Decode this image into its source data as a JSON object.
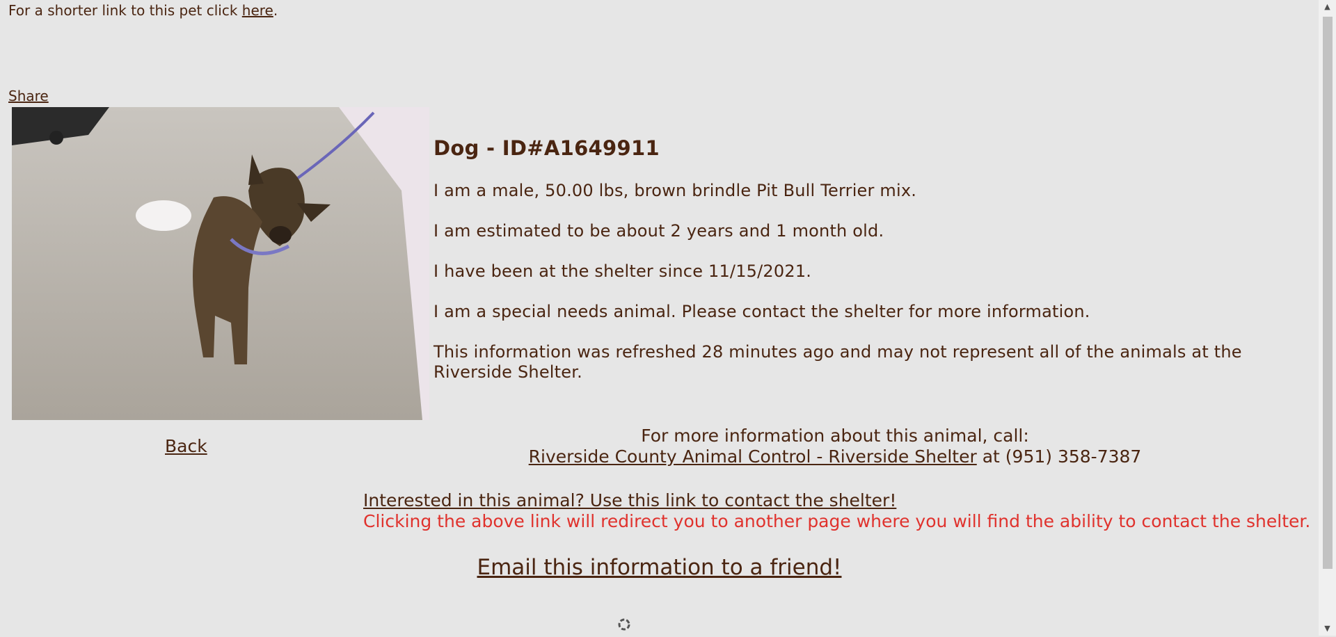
{
  "header": {
    "short_link_prefix": "For a shorter link to this pet click ",
    "short_link_label": "here",
    "short_link_suffix": ".",
    "share_label": "Share"
  },
  "animal": {
    "title": "Dog - ID#A1649911",
    "description": "I am a male, 50.00 lbs, brown brindle Pit Bull Terrier mix.",
    "age": "I am estimated to be about 2 years and 1 month old.",
    "shelter_since": "I have been at the shelter since 11/15/2021.",
    "special_needs": "I am a special needs animal. Please contact the shelter for more information.",
    "refresh_note": "This information was refreshed 28 minutes ago and may not represent all of the animals at the Riverside Shelter."
  },
  "nav": {
    "back_label": "Back"
  },
  "call": {
    "intro": "For more information about this animal, call:",
    "shelter_link": "Riverside County Animal Control - Riverside Shelter",
    "phone_text": " at (951) 358-7387"
  },
  "contact": {
    "link": "Interested in this animal? Use this link to contact the shelter!",
    "redirect_note": "Clicking the above link will redirect you to another page where you will find the ability to contact the shelter."
  },
  "email": {
    "label": "Email this information to a friend!"
  },
  "colors": {
    "text": "#4a2511",
    "warning": "#e0322d",
    "background": "#e6e6e6"
  }
}
